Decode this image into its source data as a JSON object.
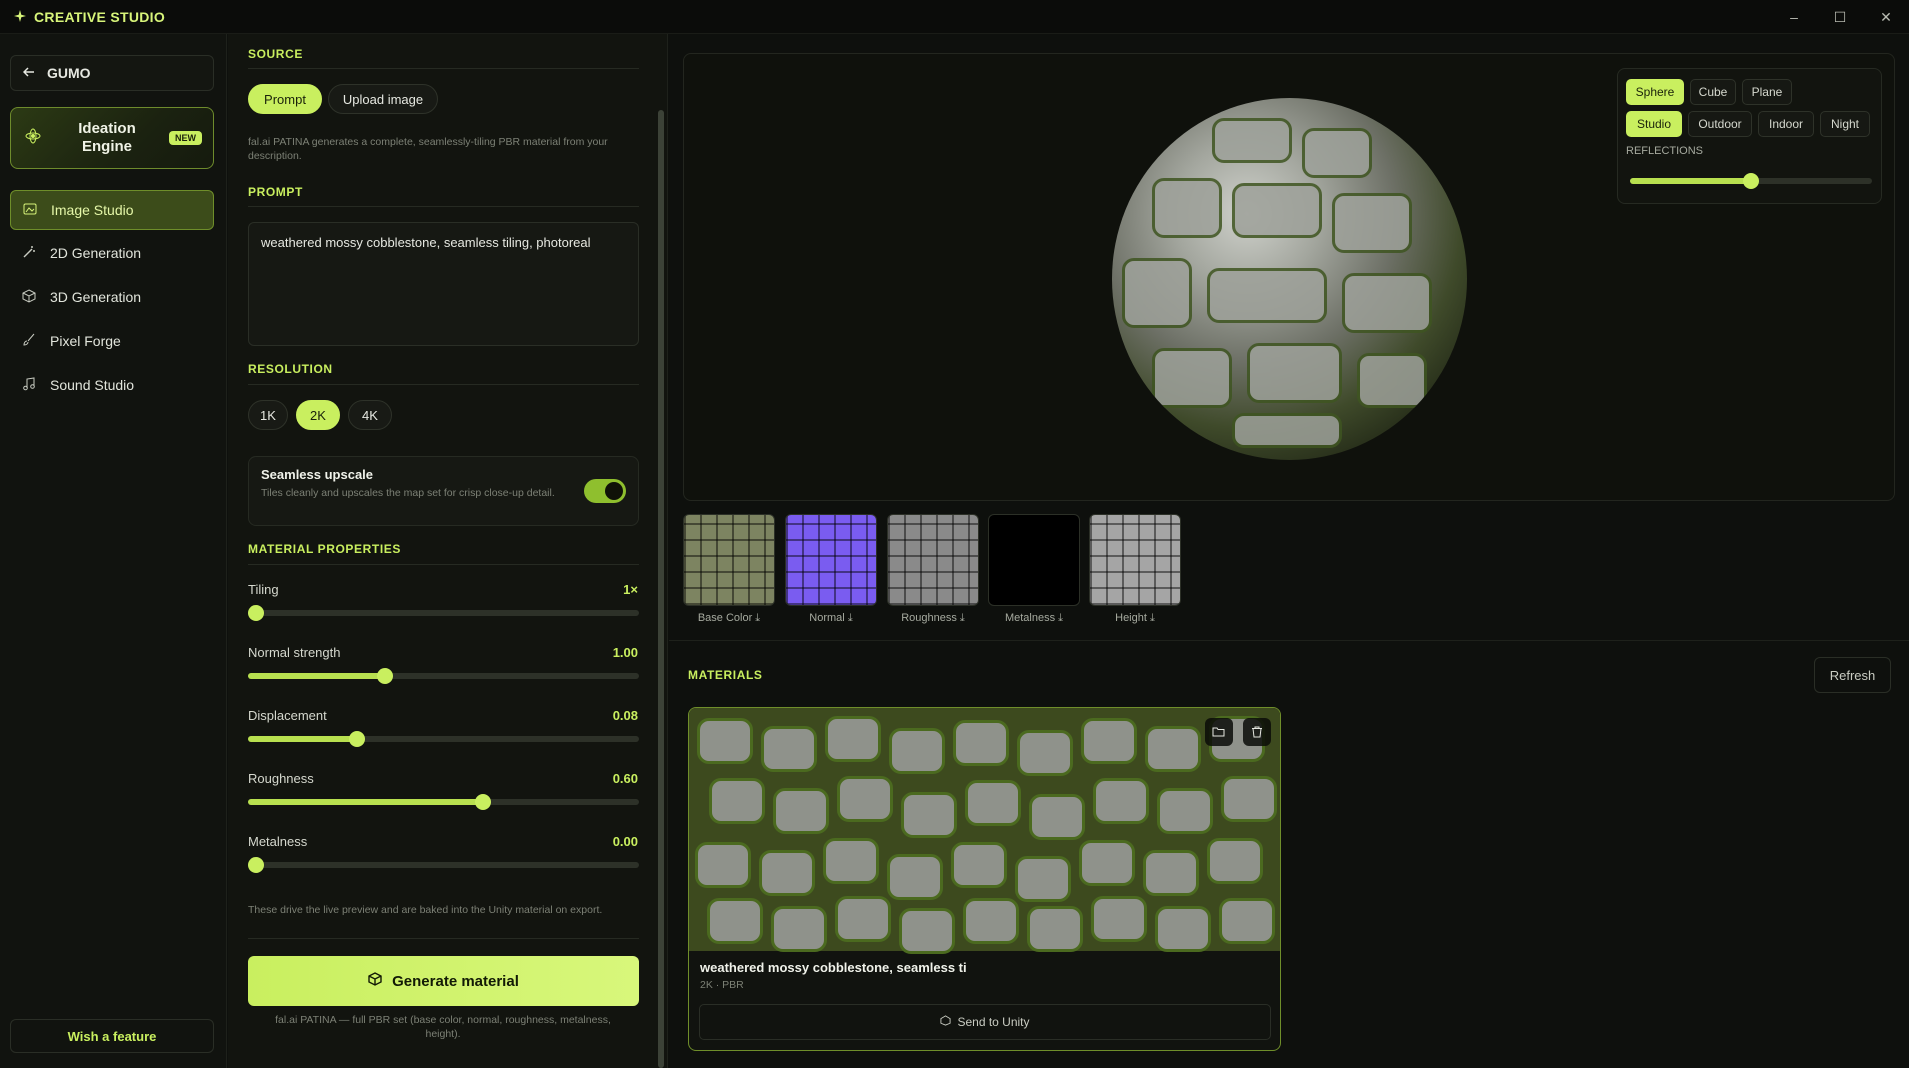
{
  "app": {
    "title": "CREATIVE STUDIO"
  },
  "window": {
    "minimize": "–",
    "maximize": "☐",
    "close": "✕"
  },
  "sidebar": {
    "back_label": "GUMO",
    "ideation": {
      "label": "Ideation Engine",
      "badge": "NEW"
    },
    "items": [
      {
        "label": "Image Studio",
        "active": true
      },
      {
        "label": "2D Generation",
        "active": false
      },
      {
        "label": "3D Generation",
        "active": false
      },
      {
        "label": "Pixel Forge",
        "active": false
      },
      {
        "label": "Sound Studio",
        "active": false
      }
    ],
    "wish_label": "Wish a feature"
  },
  "panel": {
    "source_title": "SOURCE",
    "source_tabs": [
      {
        "label": "Prompt",
        "active": true
      },
      {
        "label": "Upload image",
        "active": false
      }
    ],
    "source_desc": "fal.ai PATINA generates a complete, seamlessly-tiling PBR material from your description.",
    "prompt_title": "PROMPT",
    "prompt_value": "weathered mossy cobblestone, seamless tiling, photoreal",
    "resolution_title": "RESOLUTION",
    "resolutions": [
      {
        "label": "1K",
        "active": false
      },
      {
        "label": "2K",
        "active": true
      },
      {
        "label": "4K",
        "active": false
      }
    ],
    "seamless": {
      "title": "Seamless upscale",
      "desc": "Tiles cleanly and upscales the map set for crisp close-up detail.",
      "enabled": true
    },
    "material_title": "MATERIAL PROPERTIES",
    "sliders": [
      {
        "label": "Tiling",
        "value": "1×",
        "fraction": 0.0
      },
      {
        "label": "Normal strength",
        "value": "1.00",
        "fraction": 0.35
      },
      {
        "label": "Displacement",
        "value": "0.08",
        "fraction": 0.28
      },
      {
        "label": "Roughness",
        "value": "0.60",
        "fraction": 0.6
      },
      {
        "label": "Metalness",
        "value": "0.00",
        "fraction": 0.0
      }
    ],
    "material_note": "These drive the live preview and are baked into the Unity material on export.",
    "generate_label": "Generate material",
    "footer_note": "fal.ai PATINA — full PBR set (base color, normal, roughness, metalness, height)."
  },
  "viewport": {
    "shapes": [
      {
        "label": "Sphere",
        "active": true
      },
      {
        "label": "Cube",
        "active": false
      },
      {
        "label": "Plane",
        "active": false
      }
    ],
    "lighting": [
      {
        "label": "Studio",
        "active": true
      },
      {
        "label": "Outdoor",
        "active": false
      },
      {
        "label": "Indoor",
        "active": false
      },
      {
        "label": "Night",
        "active": false
      }
    ],
    "reflections_label": "REFLECTIONS",
    "reflections_fraction": 0.5
  },
  "maps": [
    {
      "label": "Base Color",
      "color": "#7d8461"
    },
    {
      "label": "Normal",
      "color": "#7a5cf0"
    },
    {
      "label": "Roughness",
      "color": "#8a8a8a"
    },
    {
      "label": "Metalness",
      "color": "#000000"
    },
    {
      "label": "Height",
      "color": "#a5a5a5"
    }
  ],
  "materials": {
    "title": "MATERIALS",
    "refresh_label": "Refresh",
    "card": {
      "name": "weathered mossy cobblestone, seamless ti",
      "meta": "2K · PBR",
      "send_label": "Send to Unity"
    }
  },
  "colors": {
    "accent": "#c9ef5f",
    "background": "#0e100d",
    "panel": "#12140f"
  }
}
